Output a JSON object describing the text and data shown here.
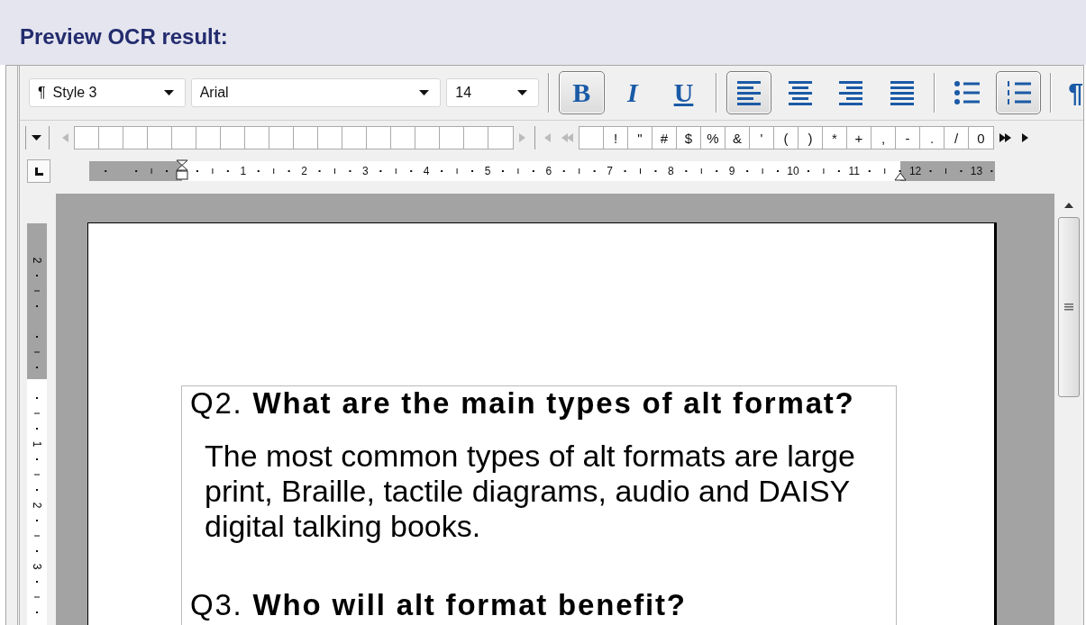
{
  "header": {
    "title": "Preview OCR result:"
  },
  "toolbar": {
    "style": {
      "icon": "¶",
      "value": "Style 3"
    },
    "font": {
      "value": "Arial"
    },
    "size": {
      "value": "14"
    },
    "format_buttons": [
      {
        "kind": "bold",
        "label": "B",
        "selected": true
      },
      {
        "kind": "italic",
        "label": "I",
        "selected": false
      },
      {
        "kind": "underline",
        "label": "U",
        "selected": false
      }
    ],
    "align_buttons": [
      {
        "kind": "left",
        "selected": true
      },
      {
        "kind": "center",
        "selected": false
      },
      {
        "kind": "right",
        "selected": false
      },
      {
        "kind": "justify",
        "selected": false
      }
    ],
    "list_buttons": [
      {
        "kind": "bullets",
        "selected": false
      },
      {
        "kind": "numbered",
        "selected": true
      }
    ],
    "paragraph_button": {
      "label": "¶"
    }
  },
  "character_bar": {
    "characters": [
      "!",
      "\"",
      "#",
      "$",
      "%",
      "&",
      "'",
      "(",
      ")",
      "*",
      "+",
      ",",
      "-",
      ".",
      "/",
      "0"
    ]
  },
  "ruler": {
    "labels": [
      "1",
      "2",
      "3",
      "4",
      "5",
      "6",
      "7",
      "8",
      "9",
      "10",
      "11",
      "12",
      "13"
    ]
  },
  "vertical_ruler": {
    "labels": [
      "2",
      "1",
      "2",
      "3"
    ]
  },
  "document": {
    "heading": "Q2. **What are the main types of alt format?**",
    "paragraph": "The most common types of alt formats are large print, Braille, tactile diagrams, audio and DAISY digital talking books.",
    "next_heading": "Q3. **Who will alt format benefit?**"
  }
}
